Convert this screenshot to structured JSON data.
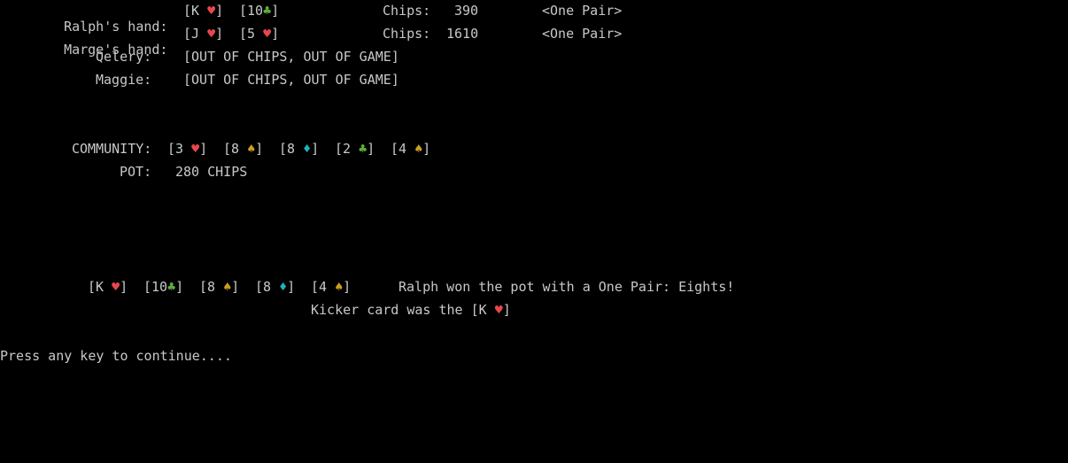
{
  "players": [
    {
      "label": "Ralph's hand:",
      "cards": [
        {
          "rank": "K",
          "suit": "♥",
          "color": "#e8474b"
        },
        {
          "rank": "10",
          "suit": "♣",
          "color": "#5fae3b"
        }
      ],
      "chips_label": "Chips:",
      "chips": "390",
      "hand_rank": "<One Pair>"
    },
    {
      "label": "Marge's hand:",
      "cards": [
        {
          "rank": "J",
          "suit": "♥",
          "color": "#e8474b"
        },
        {
          "rank": "5",
          "suit": "♥",
          "color": "#e8474b"
        }
      ],
      "chips_label": "Chips:",
      "chips": "1610",
      "hand_rank": "<One Pair>"
    },
    {
      "label": "Qelery:",
      "status": "[OUT OF CHIPS, OUT OF GAME]"
    },
    {
      "label": "Maggie:",
      "status": "[OUT OF CHIPS, OUT OF GAME]"
    }
  ],
  "community": {
    "label": "COMMUNITY:",
    "cards": [
      {
        "rank": "3",
        "suit": "♥",
        "color": "#e8474b"
      },
      {
        "rank": "8",
        "suit": "♠",
        "color": "#c8a020"
      },
      {
        "rank": "8",
        "suit": "♦",
        "color": "#20b0b8"
      },
      {
        "rank": "2",
        "suit": "♣",
        "color": "#5fae3b"
      },
      {
        "rank": "4",
        "suit": "♠",
        "color": "#c8a020"
      }
    ]
  },
  "pot": {
    "label": "POT:",
    "value": "280 CHIPS"
  },
  "winning_hand": {
    "cards": [
      {
        "rank": "K",
        "suit": "♥",
        "color": "#e8474b"
      },
      {
        "rank": "10",
        "suit": "♣",
        "color": "#5fae3b"
      },
      {
        "rank": "8",
        "suit": "♠",
        "color": "#c8a020"
      },
      {
        "rank": "8",
        "suit": "♦",
        "color": "#20b0b8"
      },
      {
        "rank": "4",
        "suit": "♠",
        "color": "#c8a020"
      }
    ],
    "message": "Ralph won the pot with a One Pair: Eights!",
    "kicker_prefix": "Kicker card was the ",
    "kicker_card": {
      "rank": "K",
      "suit": "♥",
      "color": "#e8474b"
    }
  },
  "prompt": "Press any key to continue....",
  "colors": {
    "background": "#000000",
    "text": "#c8c8c8",
    "hearts": "#e8474b",
    "spades": "#c8a020",
    "clubs": "#5fae3b",
    "diamonds": "#20b0b8"
  }
}
